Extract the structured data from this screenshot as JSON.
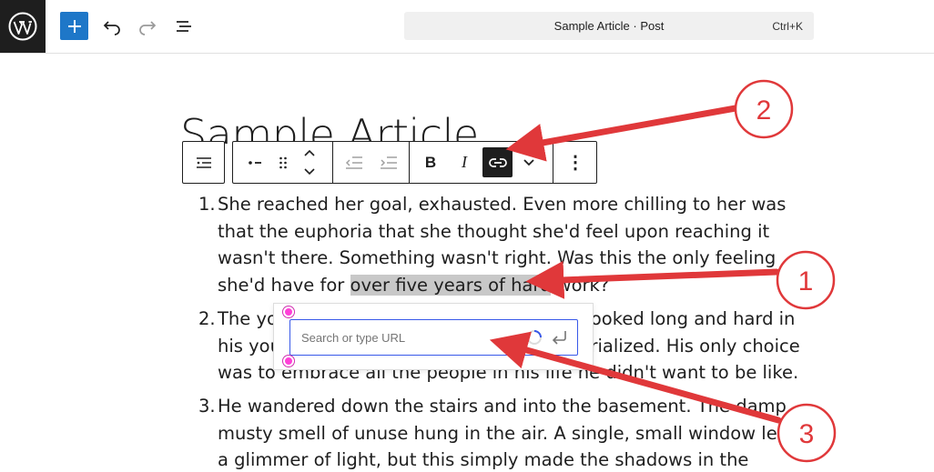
{
  "topbar": {
    "logo_icon": "wordpress-icon",
    "inserter_icon": "plus-icon",
    "undo_icon": "undo-icon",
    "redo_icon": "redo-icon",
    "outline_icon": "list-view-icon",
    "command_title": "Sample Article · Post",
    "command_shortcut": "Ctrl+K"
  },
  "post": {
    "title": "Sample Article"
  },
  "block_toolbar": {
    "icons": [
      "list-block-icon",
      "indent-list-icon",
      "drag-handle-icon",
      "move-up-icon",
      "move-down-icon",
      "outdent-icon",
      "indent-icon",
      "bold-icon",
      "italic-icon",
      "link-icon",
      "chevron-down-icon",
      "more-options-icon"
    ],
    "bold_label": "B",
    "italic_label": "I",
    "more_label": "⋮"
  },
  "list": {
    "items": [
      {
        "number": "1.",
        "lines": [
          "She reached her goal, exhausted. Even more chilling to her was",
          "that the euphoria that she thought she'd feel upon reaching it",
          "wasn't there. Something wasn't right. Was this the only feeling"
        ],
        "last_before": "she'd have for ",
        "last_highlight": "over five years of hard",
        "last_after": " work?"
      },
      {
        "number": "2.",
        "lines": [
          "The young man wanted a role model. He looked long and hard in",
          "his youth, but that role model never materialized. His only choice",
          "was to embrace all the people in his life he didn't want to be like."
        ]
      },
      {
        "number": "3.",
        "lines": [
          "He wandered down the stairs and into the basement. The damp,",
          "musty smell of unuse hung in the air. A single, small window let in",
          "a glimmer of light, but this simply made the shadows in the"
        ]
      }
    ]
  },
  "link_popover": {
    "placeholder": "Search or type URL",
    "value": "",
    "spinner_icon": "spinner-icon",
    "submit_icon": "enter-icon"
  },
  "annotations": {
    "labels": [
      "1",
      "2",
      "3"
    ],
    "color": "#e0383a"
  }
}
